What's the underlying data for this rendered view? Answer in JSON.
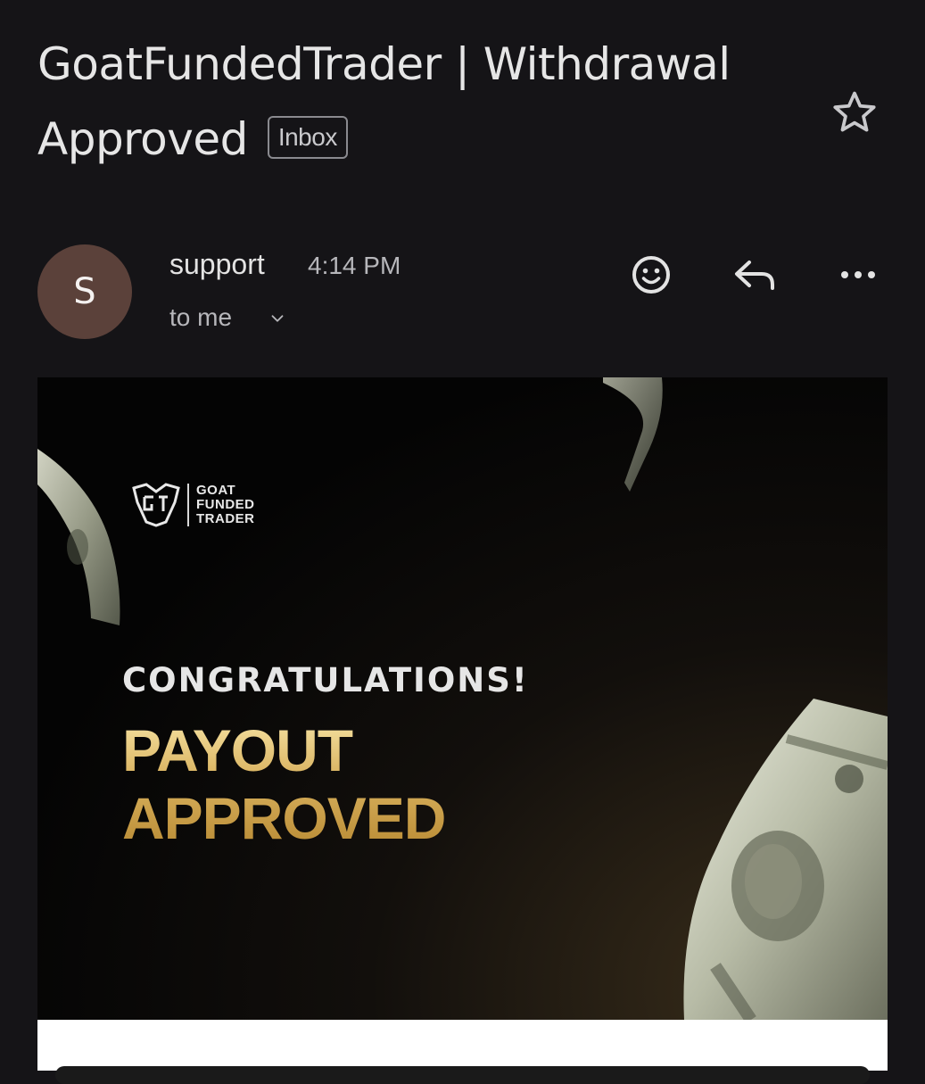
{
  "email": {
    "subject": "GoatFundedTrader | Withdrawal Approved",
    "label": "Inbox",
    "sender": {
      "initial": "S",
      "name": "support",
      "time": "4:14 PM",
      "recipient": "to me"
    }
  },
  "icons": {
    "star": "star-icon",
    "emoji": "emoji-react-icon",
    "reply": "reply-icon",
    "more": "more-horizontal-icon",
    "expand": "chevron-down-icon"
  },
  "banner": {
    "logo_lines": [
      "GOAT",
      "FUNDED",
      "TRADER"
    ],
    "headline": "CONGRATULATIONS!",
    "title_line1": "PAYOUT",
    "title_line2": "APPROVED"
  },
  "colors": {
    "background": "#151417",
    "avatar": "#5b413a",
    "gold": "#d9b25f"
  }
}
